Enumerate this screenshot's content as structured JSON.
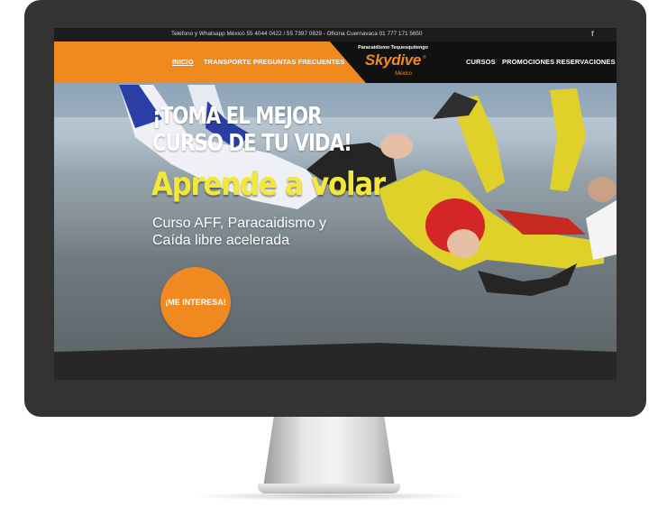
{
  "topbar": {
    "contact_text": "Teléfono y Whatsapp México 55 4044 0422 / 55 7397 0829 - Oficina Cuernavaca 01 777 171 5650",
    "social_icon": "facebook-icon",
    "social_glyph": "f"
  },
  "nav": {
    "left_items": [
      {
        "label": "INICIO",
        "active": true
      },
      {
        "label": "TRANSPORTE"
      },
      {
        "label": "PREGUNTAS FRECUENTES"
      }
    ],
    "right_items": [
      {
        "label": "CURSOS"
      },
      {
        "label": "PROMOCIONES"
      },
      {
        "label": "RESERVACIONES"
      }
    ]
  },
  "logo": {
    "tagline": "Paracaidismo Tequesquitengo",
    "name": "Skydive",
    "sub": "México",
    "reg": "®"
  },
  "hero": {
    "headline_line1": "¡TOMA EL MEJOR",
    "headline_line2": "CURSO DE TU VIDA!",
    "tagline": "Aprende a volar",
    "sub_line1": "Curso AFF, Paracaidismo y",
    "sub_line2": "Caída libre acelerada",
    "cta_label": "¡ME INTERESA!"
  },
  "colors": {
    "brand_orange": "#f08a1e",
    "headline_yellow": "#f3e73a",
    "bezel": "#333333"
  }
}
